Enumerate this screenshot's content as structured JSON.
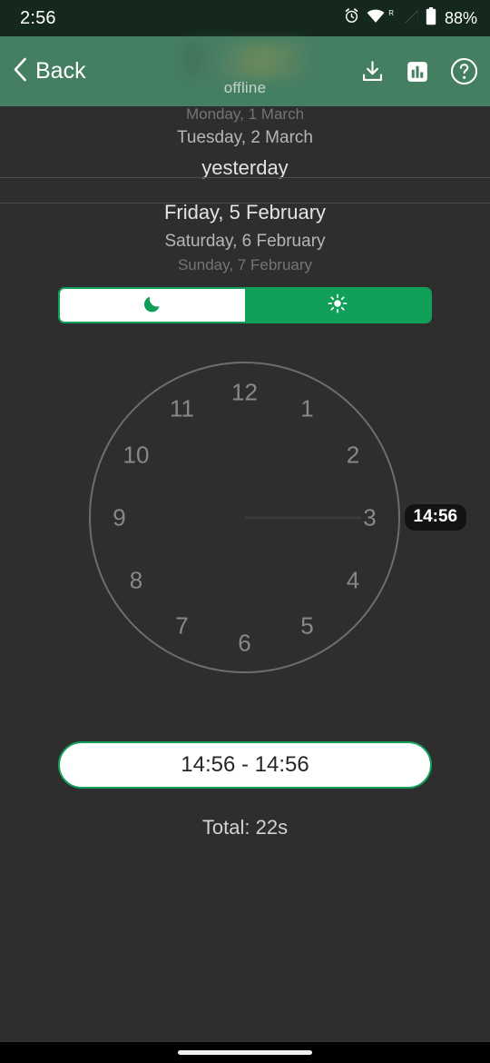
{
  "status_bar": {
    "time": "2:56",
    "battery_percent": "88%",
    "roaming_indicator": "R",
    "icons": [
      "alarm-icon",
      "wifi-icon",
      "cellular-signal-icon",
      "battery-icon"
    ]
  },
  "app_bar": {
    "back_label": "Back",
    "title": "",
    "title_redacted": true,
    "subtitle": "offline",
    "actions": [
      {
        "name": "download-icon",
        "label": "download"
      },
      {
        "name": "statistics-icon",
        "label": "statistics"
      },
      {
        "name": "help-icon",
        "label": "help"
      }
    ]
  },
  "date_wheel_top": {
    "rows": [
      {
        "text": "Monday, 1 March",
        "state": "dim"
      },
      {
        "text": "Tuesday, 2 March",
        "state": "near"
      },
      {
        "text": "yesterday",
        "state": "selected"
      }
    ]
  },
  "date_wheel_bottom": {
    "rows": [
      {
        "text": "Friday, 5 February",
        "state": "selected"
      },
      {
        "text": "Saturday, 6 February",
        "state": "near"
      },
      {
        "text": "Sunday, 7 February",
        "state": "dim"
      }
    ]
  },
  "mode_toggle": {
    "night": {
      "icon": "moon-icon",
      "selected": false
    },
    "day": {
      "icon": "sun-icon",
      "selected": true
    },
    "accent_color": "#10a05a"
  },
  "clock": {
    "hour_numbers": [
      "12",
      "1",
      "2",
      "3",
      "4",
      "5",
      "6",
      "7",
      "8",
      "9",
      "10",
      "11"
    ],
    "badge_label": "14:56",
    "badge_angle_hours": 3,
    "face_color": "#6d6d6d"
  },
  "interval": {
    "label": "14:56 - 14:56",
    "start": "14:56",
    "end": "14:56"
  },
  "total": {
    "label": "Total: 22s",
    "value": "22s"
  },
  "nav_bar": {
    "home_indicator": "home-pill"
  }
}
